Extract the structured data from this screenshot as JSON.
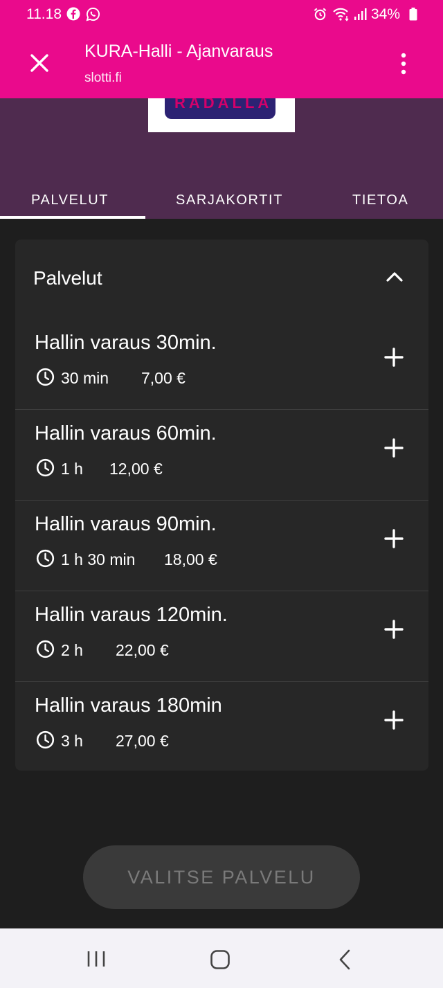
{
  "status_bar": {
    "time": "11.18",
    "battery": "34%"
  },
  "browser_tab": {
    "title": "KURA-Halli - Ajanvaraus",
    "url": "slotti.fi"
  },
  "logo": {
    "text": "RADALLA"
  },
  "tabs": [
    {
      "label": "PALVELUT",
      "active": true
    },
    {
      "label": "SARJAKORTIT",
      "active": false
    },
    {
      "label": "TIETOA",
      "active": false
    }
  ],
  "services": {
    "heading": "Palvelut",
    "items": [
      {
        "name": "Hallin varaus 30min.",
        "duration": "30 min",
        "price": "7,00 €"
      },
      {
        "name": "Hallin varaus 60min.",
        "duration": "1 h",
        "price": "12,00 €"
      },
      {
        "name": "Hallin varaus 90min.",
        "duration": "1 h 30 min",
        "price": "18,00 €"
      },
      {
        "name": "Hallin varaus 120min.",
        "duration": "2 h",
        "price": "22,00 €"
      },
      {
        "name": "Hallin varaus 180min",
        "duration": "3 h",
        "price": "27,00 €"
      }
    ]
  },
  "cta": {
    "label": "VALITSE PALVELU"
  },
  "colors": {
    "brand_pink": "#ea0a8c",
    "header_purple": "#4f2b4f",
    "background": "#1e1e1e",
    "card": "#272727"
  },
  "icons": [
    "facebook-icon",
    "whatsapp-icon",
    "alarm-icon",
    "wifi-icon",
    "signal-icon",
    "battery-icon",
    "close-icon",
    "more-vert-icon",
    "chevron-up-icon",
    "clock-icon",
    "plus-icon",
    "recent-apps-icon",
    "home-icon",
    "back-icon"
  ]
}
